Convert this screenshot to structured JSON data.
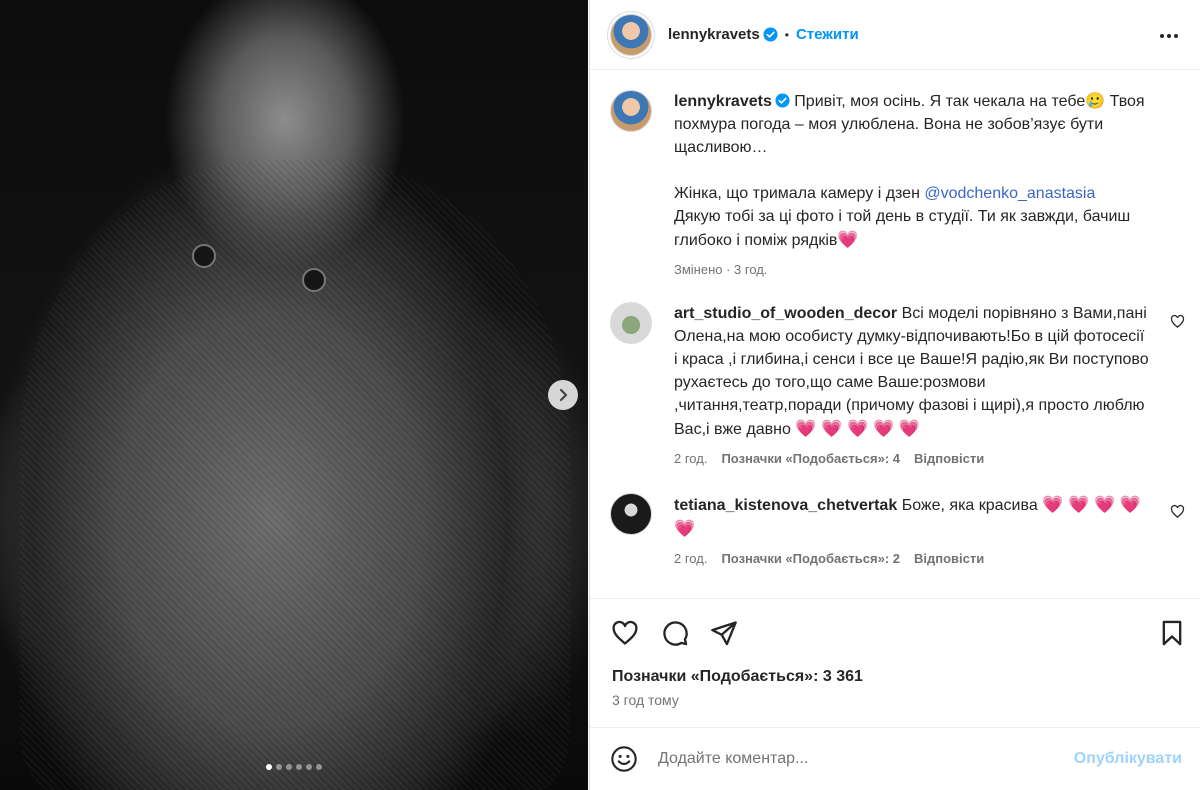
{
  "post": {
    "media": {
      "carousel": {
        "total": 6,
        "active_index": 0
      },
      "next_icon": "chevron-right-icon"
    },
    "author": {
      "username": "lennykravets",
      "verified": true,
      "follow_label": "Стежити",
      "separator": "•"
    },
    "caption": {
      "username": "lennykravets",
      "text_1": "Привіт, моя осінь. Я так чекала на тебе",
      "emoji_1": "🥲",
      "text_2": " Твоя похмура погода – моя улюблена. Вона не зобов’язує бути щасливою…",
      "text_3": "Жінка, що тримала камеру і дзен ",
      "mention": "@vodchenko_anastasia",
      "text_4": "Дякую тобі за ці фото і той день в студії. Ти як завжди, бачиш глибоко і поміж рядків",
      "emoji_2": "💗",
      "meta": "Змінено · 3 год."
    },
    "comments": [
      {
        "username": "art_studio_of_wooden_decor",
        "text": "Всі моделі порівняно з Вами,пані Олена,на мою особисту думку-відпочивають!Бо в цій фотосесії і краса ,і глибина,і сенси і все це Ваше!Я радію,як Ви поступово рухаєтесь до того,що саме Ваше:розмови ,читання,театр,поради (причому фазові і щирі),я просто люблю Вас,і вже давно",
        "emojis": "💗 💗 💗 💗 💗",
        "time": "2 год.",
        "likes": "Позначки «Подобається»: 4",
        "reply": "Відповісти"
      },
      {
        "username": "tetiana_kistenova_chetvertak",
        "text": "Боже, яка красива",
        "emojis": "💗 💗 💗 💗 💗",
        "time": "2 год.",
        "likes": "Позначки «Подобається»: 2",
        "reply": "Відповісти"
      }
    ],
    "actions": {
      "like_icon": "heart-icon",
      "comment_icon": "comment-icon",
      "share_icon": "send-icon",
      "save_icon": "bookmark-icon"
    },
    "likes_text": "Позначки «Подобається»: 3 361",
    "posted_time": "3 год тому",
    "compose": {
      "emoji_icon": "smiley-icon",
      "placeholder": "Додайте коментар...",
      "publish_label": "Опублікувати"
    }
  },
  "colors": {
    "link": "#0095f6",
    "mention": "#3b66c7",
    "publish_disabled": "#9fd3fb",
    "heart_emoji": "#e23a6e"
  }
}
